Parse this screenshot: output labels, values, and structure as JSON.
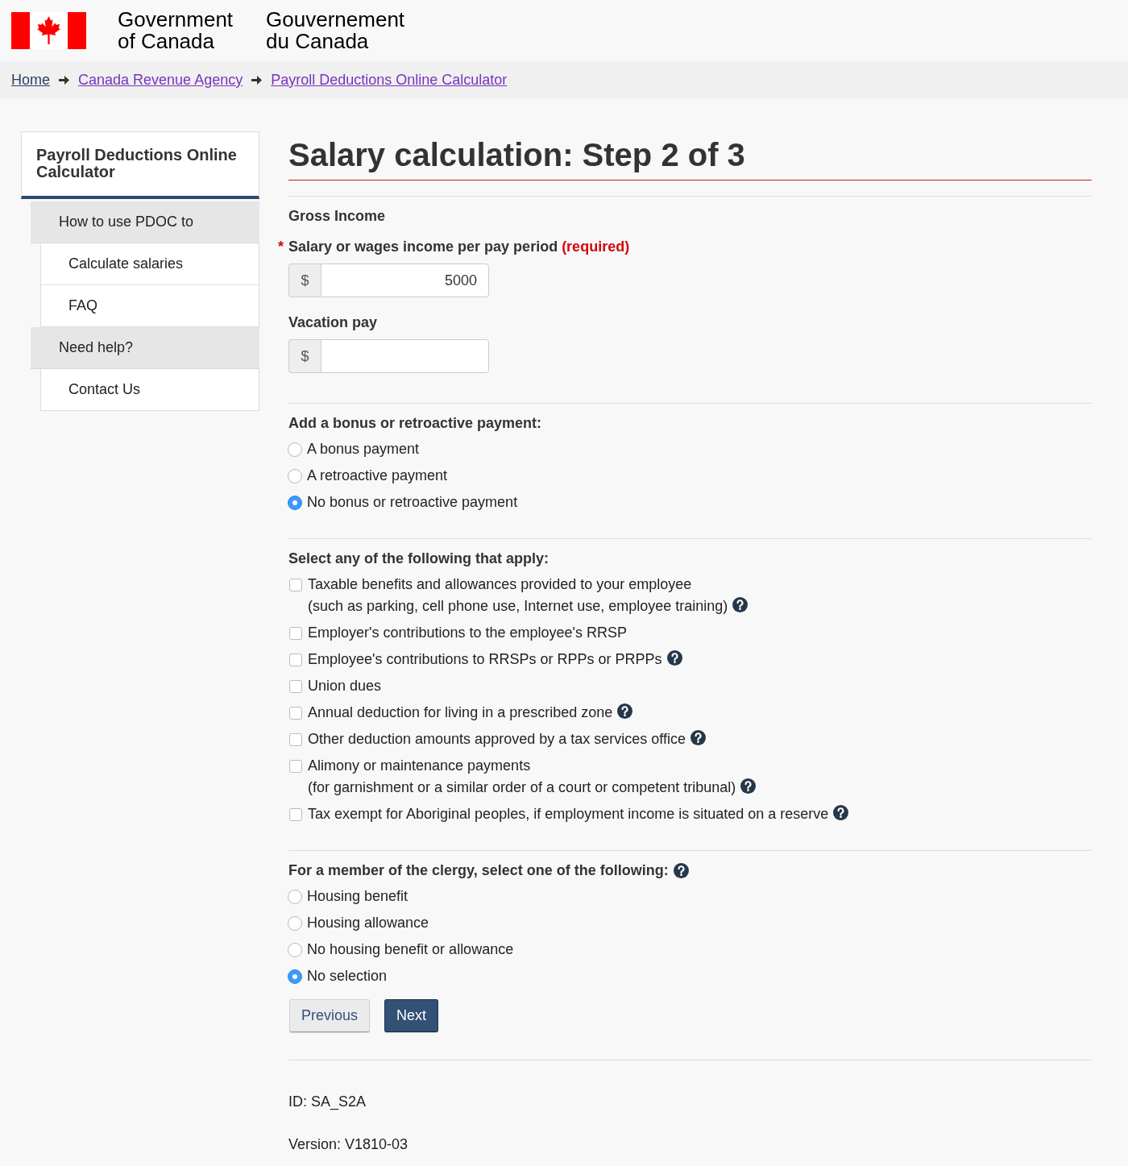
{
  "header": {
    "wordmark_en": [
      "Government",
      "of Canada"
    ],
    "wordmark_fr": [
      "Gouvernement",
      "du Canada"
    ]
  },
  "breadcrumb": [
    {
      "label": "Home",
      "visited": false
    },
    {
      "label": "Canada Revenue Agency",
      "visited": true
    },
    {
      "label": "Payroll Deductions Online Calculator",
      "visited": true
    }
  ],
  "sidebar": {
    "title": "Payroll Deductions Online Calculator",
    "items": [
      {
        "label": "How to use PDOC to",
        "children": [
          {
            "label": "Calculate salaries"
          },
          {
            "label": "FAQ"
          }
        ]
      },
      {
        "label": "Need help?",
        "children": [
          {
            "label": "Contact Us"
          }
        ]
      }
    ]
  },
  "page_title": "Salary calculation: Step 2 of 3",
  "gross_income": {
    "heading": "Gross Income",
    "fields": [
      {
        "label": "Salary or wages income per pay period",
        "required_mark": "*",
        "required_note": "(required)",
        "prefix": "$",
        "value": "5000"
      },
      {
        "label": "Vacation pay",
        "prefix": "$"
      }
    ]
  },
  "bonus": {
    "heading": "Add a bonus or retroactive payment:",
    "options": [
      {
        "label": "A bonus payment",
        "selected": false
      },
      {
        "label": "A retroactive payment",
        "selected": false
      },
      {
        "label": "No bonus or retroactive payment",
        "selected": true
      }
    ]
  },
  "deductions": {
    "heading": "Select any of the following that apply:",
    "options": [
      {
        "label": "Taxable benefits and allowances provided to your employee",
        "detail": "(such as parking, cell phone use, Internet use, employee training)",
        "checked": false,
        "help": true
      },
      {
        "label": "Employer's contributions to the employee's RRSP",
        "checked": false,
        "help": false
      },
      {
        "label": "Employee's contributions to RRSPs or RPPs or PRPPs",
        "checked": false,
        "help": true
      },
      {
        "label": "Union dues",
        "checked": false,
        "help": false
      },
      {
        "label": "Annual deduction for living in a prescribed zone",
        "checked": false,
        "help": true
      },
      {
        "label": "Other deduction amounts approved by a tax services office",
        "checked": false,
        "help": true
      },
      {
        "label": "Alimony or maintenance payments",
        "detail": "(for garnishment or a similar order of a court or competent tribunal)",
        "checked": false,
        "help": true
      },
      {
        "label": "Tax exempt for Aboriginal peoples, if employment income is situated on a reserve",
        "checked": false,
        "help": true
      }
    ]
  },
  "clergy": {
    "heading": "For a member of the clergy, select one of the following:",
    "help": true,
    "options": [
      {
        "label": "Housing benefit",
        "selected": false
      },
      {
        "label": "Housing allowance",
        "selected": false
      },
      {
        "label": "No housing benefit or allowance",
        "selected": false
      },
      {
        "label": "No selection",
        "selected": true
      }
    ]
  },
  "buttons": [
    {
      "label": "Previous",
      "kind": "secondary"
    },
    {
      "label": "Next",
      "kind": "primary"
    }
  ],
  "footer": {
    "id": "ID: SA_S2A",
    "version": "Version: V1810-03"
  }
}
